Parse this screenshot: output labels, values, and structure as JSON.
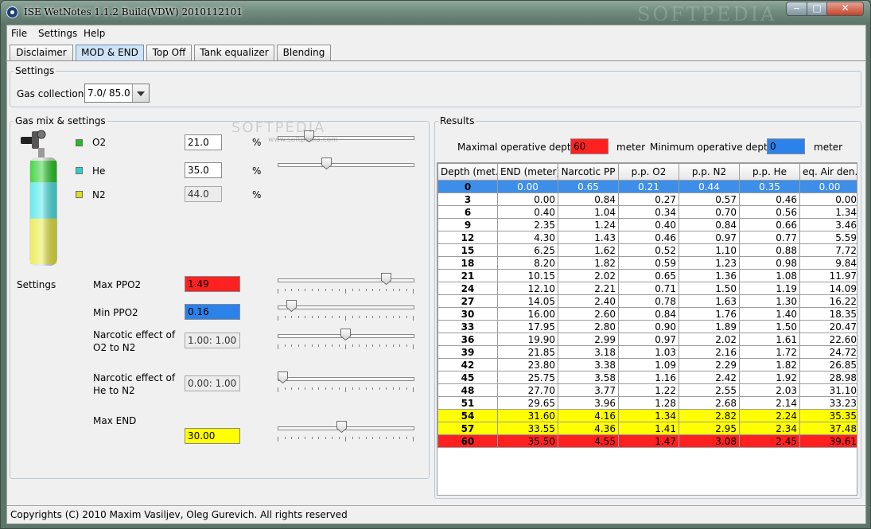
{
  "window": {
    "title": "ISE WetNotes 1.1.2 Build(VDW) 2010112101",
    "watermark": "SOFTPEDIA",
    "controls": {
      "minimize": "‒",
      "maximize": "□",
      "close": "✕"
    }
  },
  "menu": [
    "File",
    "Settings",
    "Help"
  ],
  "tabs": [
    {
      "label": "Disclaimer",
      "active": false
    },
    {
      "label": "MOD & END",
      "active": true
    },
    {
      "label": "Top Off",
      "active": false
    },
    {
      "label": "Tank equalizer",
      "active": false
    },
    {
      "label": "Blending",
      "active": false
    }
  ],
  "settings_top": {
    "title": "Settings",
    "gas_collection_label": "Gas collection",
    "gas_collection_value": "7.0/ 85.0"
  },
  "gas_mix": {
    "title": "Gas mix & settings",
    "o2": {
      "label": "O2",
      "value": "21.0",
      "unit": "%",
      "color": "#22bb22",
      "slider_fraction": 0.21
    },
    "he": {
      "label": "He",
      "value": "35.0",
      "unit": "%",
      "color": "#33cccc",
      "slider_fraction": 0.35
    },
    "n2": {
      "label": "N2",
      "value": "44.0",
      "unit": "%",
      "color": "#dddd22"
    },
    "tank_fill": {
      "o2_fraction": 0.21,
      "he_fraction": 0.35,
      "n2_fraction": 0.44
    },
    "watermark": "SOFTPEDIA",
    "watermark_url": "www.softpedia.com"
  },
  "settings": {
    "section_label": "Settings",
    "max_ppo2": {
      "label": "Max PPO2",
      "value": "1.49",
      "color": "#ff2020",
      "slider_fraction": 0.82
    },
    "min_ppo2": {
      "label": "Min PPO2",
      "value": "0.16",
      "color": "#2a82ea",
      "slider_fraction": 0.07
    },
    "narcotic_o2": {
      "label_line1": "Narcotic effect of",
      "label_line2": "O2 to N2",
      "value": "1.00: 1.00",
      "slider_fraction": 0.5
    },
    "narcotic_he": {
      "label_line1": "Narcotic effect of",
      "label_line2": "He to N2",
      "value": "0.00: 1.00",
      "slider_fraction": 0.0
    },
    "max_end": {
      "label": "Max END",
      "value": "30.00",
      "color": "#ffff00",
      "slider_fraction": 0.47
    }
  },
  "results": {
    "title": "Results",
    "mod_label": "Maximal operative depth",
    "mod_value": "60",
    "mod_color": "#ff2020",
    "mod_unit": "meter",
    "min_label": "Minimum operative depth",
    "min_value": "0",
    "min_color": "#2a82ea",
    "min_unit": "meter",
    "columns": [
      "Depth (met...",
      "END (meter)",
      "Narcotic PP",
      "p.p. O2",
      "p.p. N2",
      "p.p. He",
      "eq. Air den..."
    ],
    "rows": [
      {
        "style": "sel",
        "cells": [
          "0",
          "0.00",
          "0.65",
          "0.21",
          "0.44",
          "0.35",
          "0.00"
        ]
      },
      {
        "style": "",
        "cells": [
          "3",
          "0.00",
          "0.84",
          "0.27",
          "0.57",
          "0.46",
          "0.00"
        ]
      },
      {
        "style": "",
        "cells": [
          "6",
          "0.40",
          "1.04",
          "0.34",
          "0.70",
          "0.56",
          "1.34"
        ]
      },
      {
        "style": "",
        "cells": [
          "9",
          "2.35",
          "1.24",
          "0.40",
          "0.84",
          "0.66",
          "3.46"
        ]
      },
      {
        "style": "",
        "cells": [
          "12",
          "4.30",
          "1.43",
          "0.46",
          "0.97",
          "0.77",
          "5.59"
        ]
      },
      {
        "style": "",
        "cells": [
          "15",
          "6.25",
          "1.62",
          "0.52",
          "1.10",
          "0.88",
          "7.72"
        ]
      },
      {
        "style": "",
        "cells": [
          "18",
          "8.20",
          "1.82",
          "0.59",
          "1.23",
          "0.98",
          "9.84"
        ]
      },
      {
        "style": "",
        "cells": [
          "21",
          "10.15",
          "2.02",
          "0.65",
          "1.36",
          "1.08",
          "11.97"
        ]
      },
      {
        "style": "",
        "cells": [
          "24",
          "12.10",
          "2.21",
          "0.71",
          "1.50",
          "1.19",
          "14.09"
        ]
      },
      {
        "style": "",
        "cells": [
          "27",
          "14.05",
          "2.40",
          "0.78",
          "1.63",
          "1.30",
          "16.22"
        ]
      },
      {
        "style": "",
        "cells": [
          "30",
          "16.00",
          "2.60",
          "0.84",
          "1.76",
          "1.40",
          "18.35"
        ]
      },
      {
        "style": "",
        "cells": [
          "33",
          "17.95",
          "2.80",
          "0.90",
          "1.89",
          "1.50",
          "20.47"
        ]
      },
      {
        "style": "",
        "cells": [
          "36",
          "19.90",
          "2.99",
          "0.97",
          "2.02",
          "1.61",
          "22.60"
        ]
      },
      {
        "style": "",
        "cells": [
          "39",
          "21.85",
          "3.18",
          "1.03",
          "2.16",
          "1.72",
          "24.72"
        ]
      },
      {
        "style": "",
        "cells": [
          "42",
          "23.80",
          "3.38",
          "1.09",
          "2.29",
          "1.82",
          "26.85"
        ]
      },
      {
        "style": "",
        "cells": [
          "45",
          "25.75",
          "3.58",
          "1.16",
          "2.42",
          "1.92",
          "28.98"
        ]
      },
      {
        "style": "",
        "cells": [
          "48",
          "27.70",
          "3.77",
          "1.22",
          "2.55",
          "2.03",
          "31.10"
        ]
      },
      {
        "style": "",
        "cells": [
          "51",
          "29.65",
          "3.96",
          "1.28",
          "2.68",
          "2.14",
          "33.23"
        ]
      },
      {
        "style": "yel",
        "cells": [
          "54",
          "31.60",
          "4.16",
          "1.34",
          "2.82",
          "2.24",
          "35.35"
        ]
      },
      {
        "style": "yel",
        "cells": [
          "57",
          "33.55",
          "4.36",
          "1.41",
          "2.95",
          "2.34",
          "37.48"
        ]
      },
      {
        "style": "red",
        "cells": [
          "60",
          "35.50",
          "4.55",
          "1.47",
          "3.08",
          "2.45",
          "39.61"
        ]
      }
    ]
  },
  "status": "Copyrights (C) 2010 Maxim Vasiljev, Oleg Gurevich. All rights reserved"
}
